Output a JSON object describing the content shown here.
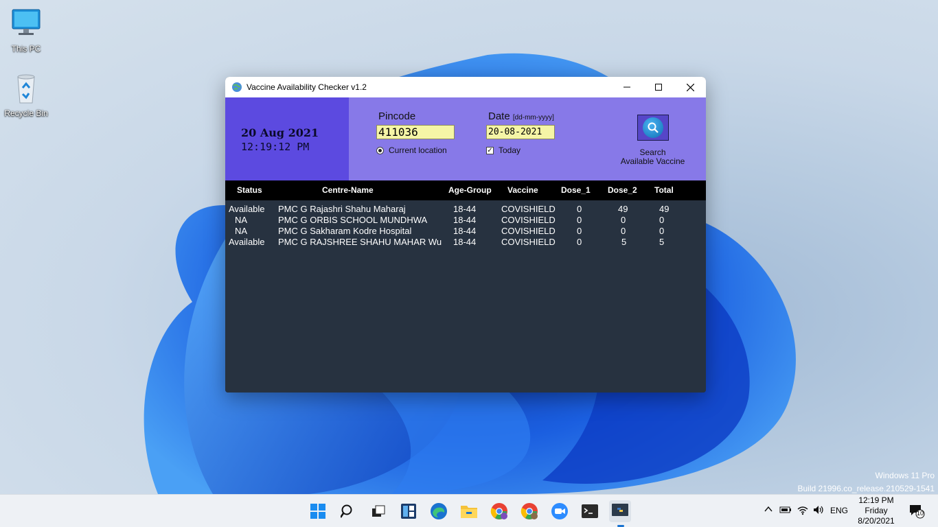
{
  "desktop": {
    "icons": [
      {
        "label": "This PC",
        "icon": "monitor-icon"
      },
      {
        "label": "Recycle Bin",
        "icon": "recycle-bin-icon"
      }
    ],
    "watermark": {
      "line1": "Windows 11 Pro",
      "line2": "Build 21996.co_release.210529-1541"
    }
  },
  "window": {
    "title": "Vaccine Availability Checker  v1.2",
    "clock": {
      "date": "20 Aug 2021",
      "time": "12:19:12 PM"
    },
    "pincode": {
      "label": "Pincode",
      "value": "411036",
      "option_label": "Current location"
    },
    "date": {
      "label": "Date",
      "format_hint": "[dd-mm-yyyy]",
      "value": "20-08-2021",
      "option_label": "Today",
      "option_checked": true
    },
    "search": {
      "line1": "Search",
      "line2": "Available Vaccine"
    },
    "columns": [
      "Status",
      "Centre-Name",
      "Age-Group",
      "Vaccine",
      "Dose_1",
      "Dose_2",
      "Total"
    ],
    "rows": [
      {
        "status": "Available",
        "centre": "PMC G Rajashri Shahu Maharaj",
        "age": "18-44",
        "vaccine": "COVISHIELD",
        "dose1": "0",
        "dose2": "49",
        "total": "49"
      },
      {
        "status": "NA",
        "centre": "PMC G ORBIS SCHOOL MUNDHWA",
        "age": "18-44",
        "vaccine": "COVISHIELD",
        "dose1": "0",
        "dose2": "0",
        "total": "0"
      },
      {
        "status": "NA",
        "centre": "PMC G Sakharam Kodre Hospital",
        "age": "18-44",
        "vaccine": "COVISHIELD",
        "dose1": "0",
        "dose2": "0",
        "total": "0"
      },
      {
        "status": "Available",
        "centre": "PMC G RAJSHREE SHAHU MAHAR Wu",
        "age": "18-44",
        "vaccine": "COVISHIELD",
        "dose1": "0",
        "dose2": "5",
        "total": "5"
      }
    ]
  },
  "taskbar": {
    "language": "ENG",
    "clock": {
      "time": "12:19 PM",
      "day": "Friday",
      "date": "8/20/2021"
    },
    "notifications": "10"
  },
  "colors": {
    "header_bg": "#8779e8",
    "clock_panel_bg": "#5c4ae0",
    "table_bg": "#273240",
    "field_bg": "#f5f5a6"
  }
}
